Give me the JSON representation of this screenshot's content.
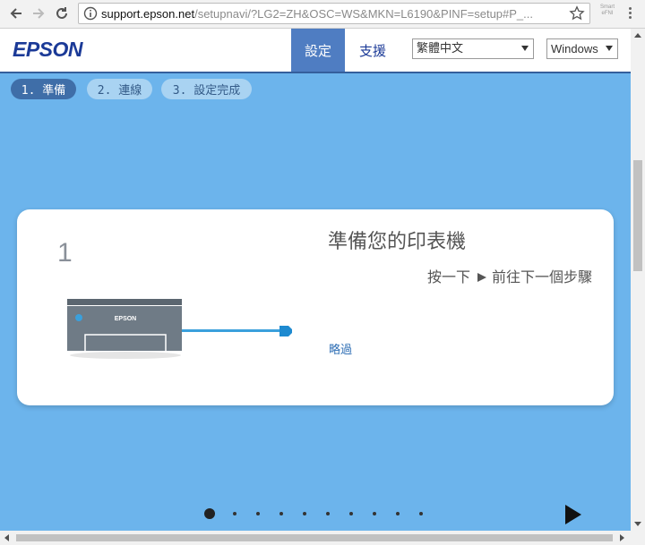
{
  "browser": {
    "url_host": "support.epson.net",
    "url_path": "/setupnavi/?LG2=ZH&OSC=WS&MKN=L6190&PINF=setup#P_...",
    "extension_label_1": "Smart",
    "extension_label_2": "eFNI"
  },
  "header": {
    "logo": "EPSON",
    "nav_setup": "設定",
    "nav_support": "支援",
    "language": "繁體中文",
    "os": "Windows"
  },
  "steps": [
    {
      "label": "1. 準備"
    },
    {
      "label": "2. 連線"
    },
    {
      "label": "3. 設定完成"
    }
  ],
  "card": {
    "step_number": "1",
    "title": "準備您的印表機",
    "next_prefix": "按一下",
    "next_suffix": "前往下一個步驟",
    "skip": "略過",
    "printer_logo": "EPSON"
  },
  "pagination": {
    "total": 10,
    "current": 1
  },
  "colors": {
    "brand": "#1b3a97",
    "accent": "#4f7dc2",
    "background": "#6cb4ec",
    "cable": "#3aa0dc"
  }
}
